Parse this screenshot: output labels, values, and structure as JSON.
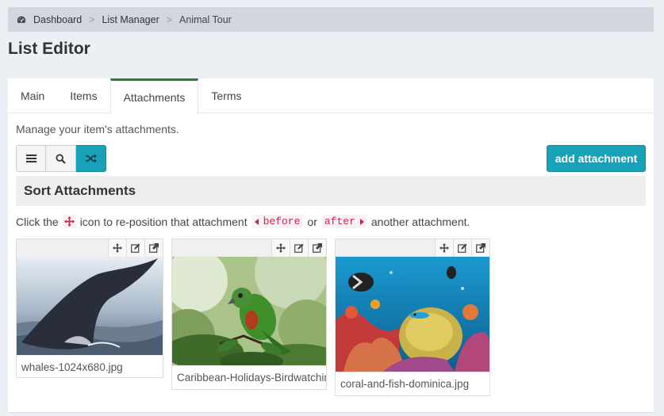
{
  "breadcrumb": {
    "items": [
      "Dashboard",
      "List Manager",
      "Animal Tour"
    ],
    "separator": ">"
  },
  "page_title": "List Editor",
  "tabs": [
    {
      "label": "Main",
      "active": false
    },
    {
      "label": "Items",
      "active": false
    },
    {
      "label": "Attachments",
      "active": true
    },
    {
      "label": "Terms",
      "active": false
    }
  ],
  "manage_text": "Manage your item's attachments.",
  "toolbar": {
    "buttons": [
      {
        "icon": "list-icon",
        "active": false
      },
      {
        "icon": "search-icon",
        "active": false
      },
      {
        "icon": "shuffle-icon",
        "active": true
      }
    ],
    "add_label": "add attachment"
  },
  "sort_header": "Sort Attachments",
  "instructions": {
    "prefix": "Click the",
    "middle": "icon to re-position that attachment",
    "before": "before",
    "or": "or",
    "after": "after",
    "suffix": "another attachment."
  },
  "attachments": [
    {
      "filename": "whales-1024x680.jpg",
      "image": "whale-tail"
    },
    {
      "filename": "Caribbean-Holidays-Birdwatching.jpg",
      "image": "green-parrot"
    },
    {
      "filename": "coral-and-fish-dominica.jpg",
      "image": "coral-reef"
    }
  ],
  "colors": {
    "accent": "#17a2b8",
    "active_tab_border": "#2e7d32",
    "code_text": "#c7254e",
    "breadcrumb_bg": "#d2d6de"
  }
}
